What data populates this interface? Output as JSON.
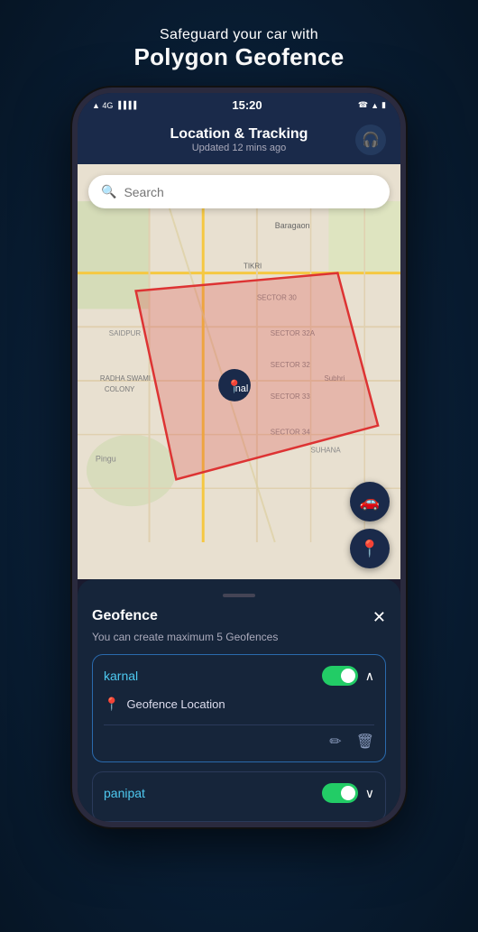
{
  "page": {
    "header_subtitle": "Safeguard your car with",
    "header_title": "Polygon Geofence"
  },
  "status_bar": {
    "time": "15:20",
    "left_icons": "4G ▲▼ ∥∥∥",
    "right_icons": "📞 WiFi 🔋"
  },
  "app_bar": {
    "title": "Location & Tracking",
    "subtitle": "Updated 12 mins ago",
    "headphone_label": "🎧"
  },
  "search": {
    "placeholder": "Search"
  },
  "map": {
    "car_icon": "🚗",
    "pin_icon": "📍"
  },
  "geofence_panel": {
    "title": "Geofence",
    "close_label": "✕",
    "description": "You can create maximum 5 Geofences",
    "items": [
      {
        "name": "karnal",
        "enabled": true,
        "expanded": true,
        "location_label": "Geofence Location"
      },
      {
        "name": "panipat",
        "enabled": true,
        "expanded": false
      }
    ]
  }
}
